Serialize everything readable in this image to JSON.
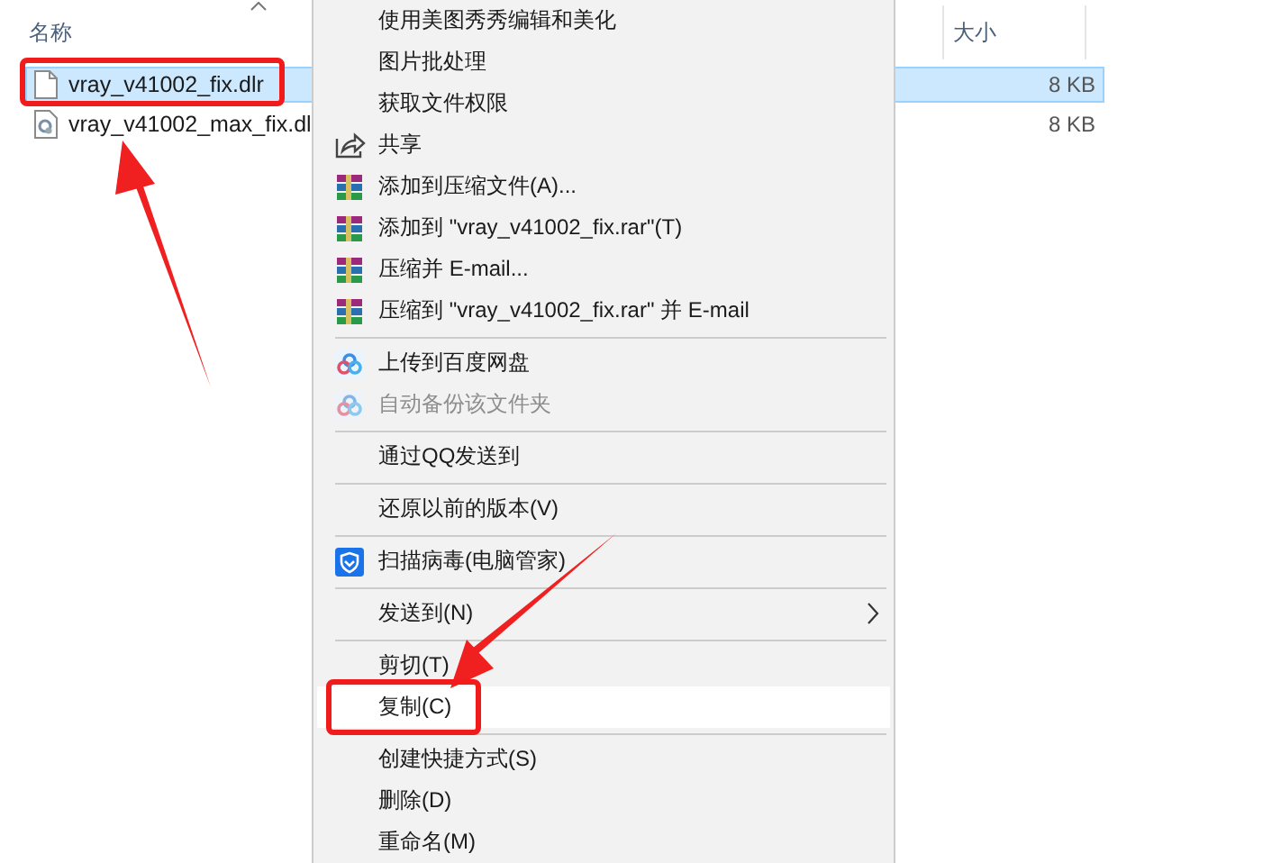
{
  "file_list": {
    "columns": [
      {
        "label": "名称",
        "sorted": true
      },
      {
        "label": "大小",
        "sorted": false
      }
    ],
    "rows": [
      {
        "name": "vray_v41002_fix.dlr",
        "size": "8 KB",
        "kind": "blank",
        "selected": true,
        "annotated": true
      },
      {
        "name": "vray_v41002_max_fix.dl",
        "size": "8 KB",
        "kind": "dll",
        "selected": false,
        "annotated": false
      }
    ]
  },
  "context_menu": {
    "items": [
      {
        "kind": "plain",
        "label": "使用美图秀秀编辑和美化",
        "disabled": false,
        "selected": false,
        "annotated": false
      },
      {
        "kind": "plain",
        "label": "图片批处理",
        "disabled": false,
        "selected": false,
        "annotated": false
      },
      {
        "kind": "plain",
        "label": "获取文件权限",
        "disabled": false,
        "selected": false,
        "annotated": false
      },
      {
        "kind": "share",
        "label": "共享",
        "disabled": false,
        "selected": false,
        "annotated": false
      },
      {
        "kind": "archive",
        "label": "添加到压缩文件(A)...",
        "disabled": false,
        "selected": false,
        "annotated": false
      },
      {
        "kind": "archive",
        "label": "添加到 \"vray_v41002_fix.rar\"(T)",
        "disabled": false,
        "selected": false,
        "annotated": false
      },
      {
        "kind": "archive",
        "label": "压缩并 E-mail...",
        "disabled": false,
        "selected": false,
        "annotated": false
      },
      {
        "kind": "archive",
        "label": "压缩到 \"vray_v41002_fix.rar\" 并 E-mail",
        "disabled": false,
        "selected": false,
        "annotated": false
      },
      {
        "kind": "separator"
      },
      {
        "kind": "cloud",
        "label": "上传到百度网盘",
        "disabled": false,
        "selected": false,
        "annotated": false
      },
      {
        "kind": "cloud",
        "label": "自动备份该文件夹",
        "disabled": true,
        "selected": false,
        "annotated": false
      },
      {
        "kind": "separator"
      },
      {
        "kind": "plain",
        "label": "通过QQ发送到",
        "disabled": false,
        "selected": false,
        "annotated": false
      },
      {
        "kind": "separator"
      },
      {
        "kind": "plain",
        "label": "还原以前的版本(V)",
        "disabled": false,
        "selected": false,
        "annotated": false
      },
      {
        "kind": "separator"
      },
      {
        "kind": "shield",
        "label": "扫描病毒(电脑管家)",
        "disabled": false,
        "selected": false,
        "annotated": false
      },
      {
        "kind": "separator"
      },
      {
        "kind": "submenu",
        "label": "发送到(N)",
        "disabled": false,
        "selected": false,
        "annotated": false
      },
      {
        "kind": "separator"
      },
      {
        "kind": "plain",
        "label": "剪切(T)",
        "disabled": false,
        "selected": false,
        "annotated": false
      },
      {
        "kind": "plain",
        "label": "复制(C)",
        "disabled": false,
        "selected": true,
        "annotated": true
      },
      {
        "kind": "separator"
      },
      {
        "kind": "plain",
        "label": "创建快捷方式(S)",
        "disabled": false,
        "selected": false,
        "annotated": false
      },
      {
        "kind": "plain",
        "label": "删除(D)",
        "disabled": false,
        "selected": false,
        "annotated": false
      },
      {
        "kind": "plain",
        "label": "重命名(M)",
        "disabled": false,
        "selected": false,
        "annotated": false
      }
    ]
  }
}
